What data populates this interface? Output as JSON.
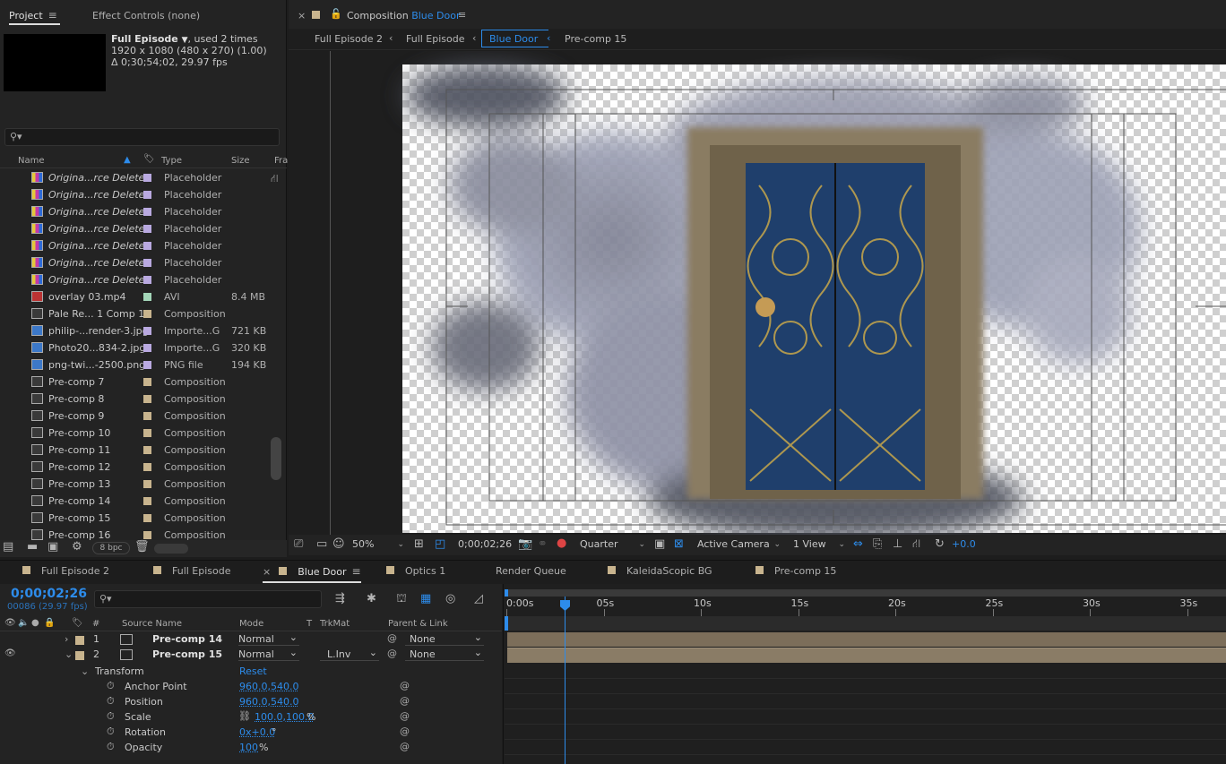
{
  "project_panel": {
    "tab_project": "Project",
    "tab_effect_controls": "Effect Controls (none)",
    "comp_name": "Full Episode",
    "used_times": ", used 2 times",
    "dimensions": "1920 x 1080  (480 x 270) (1.00)",
    "duration": "Δ 0;30;54;02, 29.97 fps",
    "col_name": "Name",
    "col_type": "Type",
    "col_size": "Size",
    "col_fr": "Fra",
    "bpc": "8 bpc",
    "items": [
      {
        "name": "Origina...rce Deleted",
        "type": "Placeholder",
        "size": "",
        "kind": "placeholder",
        "color": "#b9a9e0"
      },
      {
        "name": "Origina...rce Deleted",
        "type": "Placeholder",
        "size": "",
        "kind": "placeholder",
        "color": "#b9a9e0"
      },
      {
        "name": "Origina...rce Deleted",
        "type": "Placeholder",
        "size": "",
        "kind": "placeholder",
        "color": "#b9a9e0"
      },
      {
        "name": "Origina...rce Deleted",
        "type": "Placeholder",
        "size": "",
        "kind": "placeholder",
        "color": "#b9a9e0"
      },
      {
        "name": "Origina...rce Deleted",
        "type": "Placeholder",
        "size": "",
        "kind": "placeholder",
        "color": "#b9a9e0"
      },
      {
        "name": "Origina...rce Deleted",
        "type": "Placeholder",
        "size": "",
        "kind": "placeholder",
        "color": "#b9a9e0"
      },
      {
        "name": "Origina...rce Deleted",
        "type": "Placeholder",
        "size": "",
        "kind": "placeholder",
        "color": "#b9a9e0"
      },
      {
        "name": "overlay 03.mp4",
        "type": "AVI",
        "size": "8.4 MB",
        "kind": "video",
        "color": "#a3d6b8"
      },
      {
        "name": "Pale Re... 1 Comp 1",
        "type": "Composition",
        "size": "",
        "kind": "comp",
        "color": "#c8b48e"
      },
      {
        "name": "philip-...render-3.jpg",
        "type": "Importe...G",
        "size": "721 KB",
        "kind": "image",
        "color": "#b9a9e0"
      },
      {
        "name": "Photo20...834-2.jpg",
        "type": "Importe...G",
        "size": "320 KB",
        "kind": "image",
        "color": "#b9a9e0"
      },
      {
        "name": "png-twi...-2500.png",
        "type": "PNG file",
        "size": "194 KB",
        "kind": "image",
        "color": "#b9a9e0"
      },
      {
        "name": "Pre-comp 7",
        "type": "Composition",
        "size": "",
        "kind": "comp",
        "color": "#c8b48e"
      },
      {
        "name": "Pre-comp 8",
        "type": "Composition",
        "size": "",
        "kind": "comp",
        "color": "#c8b48e"
      },
      {
        "name": "Pre-comp 9",
        "type": "Composition",
        "size": "",
        "kind": "comp",
        "color": "#c8b48e"
      },
      {
        "name": "Pre-comp 10",
        "type": "Composition",
        "size": "",
        "kind": "comp",
        "color": "#c8b48e"
      },
      {
        "name": "Pre-comp 11",
        "type": "Composition",
        "size": "",
        "kind": "comp",
        "color": "#c8b48e"
      },
      {
        "name": "Pre-comp 12",
        "type": "Composition",
        "size": "",
        "kind": "comp",
        "color": "#c8b48e"
      },
      {
        "name": "Pre-comp 13",
        "type": "Composition",
        "size": "",
        "kind": "comp",
        "color": "#c8b48e"
      },
      {
        "name": "Pre-comp 14",
        "type": "Composition",
        "size": "",
        "kind": "comp",
        "color": "#c8b48e"
      },
      {
        "name": "Pre-comp 15",
        "type": "Composition",
        "size": "",
        "kind": "comp",
        "color": "#c8b48e"
      },
      {
        "name": "Pre-comp 16",
        "type": "Composition",
        "size": "",
        "kind": "comp",
        "color": "#c8b48e"
      }
    ]
  },
  "comp_viewer": {
    "title_prefix": "Composition",
    "title_name": "Blue Door",
    "breadcrumbs": [
      "Full Episode 2",
      "Full Episode",
      "Blue Door",
      "Pre-comp 15"
    ],
    "zoom": "50%",
    "timecode": "0;00;02;26",
    "resolution": "Quarter",
    "camera": "Active Camera",
    "views": "1 View",
    "exposure": "+0.0"
  },
  "timeline": {
    "tabs": [
      "Full Episode 2",
      "Full Episode",
      "Blue Door",
      "Optics 1",
      "Render Queue",
      "KaleidaScopic BG",
      "Pre-comp 15"
    ],
    "tab_colors": [
      "#c8b48e",
      "#c8b48e",
      "#c8b48e",
      "#c8b48e",
      "",
      "#c8b48e",
      "#c8b48e"
    ],
    "timecode": "0;00;02;26",
    "frames": "00086 (29.97 fps)",
    "col_source": "Source Name",
    "col_mode": "Mode",
    "col_t": "T",
    "col_trkmat": "TrkMat",
    "col_parent": "Parent & Link",
    "ruler": [
      "0:00s",
      "05s",
      "10s",
      "15s",
      "20s",
      "25s",
      "30s",
      "35s"
    ],
    "layers": [
      {
        "num": "1",
        "name": "Pre-comp 14",
        "mode": "Normal",
        "trkmat": "",
        "parent": "None"
      },
      {
        "num": "2",
        "name": "Pre-comp 15",
        "mode": "Normal",
        "trkmat": "L.Inv",
        "parent": "None"
      }
    ],
    "transform_label": "Transform",
    "reset_label": "Reset",
    "props": [
      {
        "name": "Anchor Point",
        "value": "960.0,540.0",
        "unit": ""
      },
      {
        "name": "Position",
        "value": "960.0,540.0",
        "unit": ""
      },
      {
        "name": "Scale",
        "value": "100.0,100.0",
        "unit": "%"
      },
      {
        "name": "Rotation",
        "value": "0x+0.0",
        "unit": "°"
      },
      {
        "name": "Opacity",
        "value": "100",
        "unit": "%"
      }
    ]
  }
}
